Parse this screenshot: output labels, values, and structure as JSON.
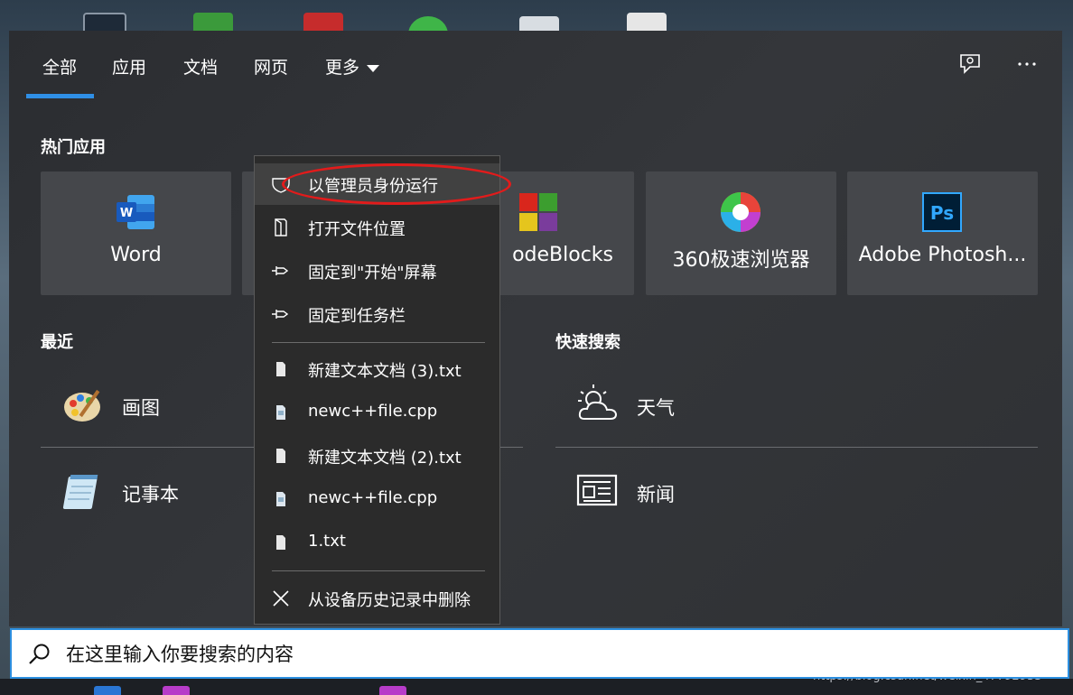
{
  "tabs": [
    {
      "label": "全部"
    },
    {
      "label": "应用"
    },
    {
      "label": "文档"
    },
    {
      "label": "网页"
    },
    {
      "label": "更多"
    }
  ],
  "top_actions": {
    "feedback_icon": "feedback-icon",
    "more_icon": "more-options-icon"
  },
  "sections": {
    "top_apps": "热门应用",
    "recent": "最近",
    "quick_search": "快速搜索"
  },
  "top_apps": [
    {
      "label": "Word",
      "icon": "word-icon",
      "color": "#185abd"
    },
    {
      "label": "",
      "icon": "hidden-app-icon"
    },
    {
      "label": "odeBlocks",
      "icon": "codeblocks-icon"
    },
    {
      "label": "360极速浏览器",
      "icon": "browser-360-icon"
    },
    {
      "label": "Adobe Photosh...",
      "icon": "photoshop-icon",
      "color": "#31a8ff"
    }
  ],
  "recent": [
    {
      "label": "画图",
      "icon": "paint-icon"
    },
    {
      "label": "记事本",
      "icon": "notepad-icon"
    }
  ],
  "quick_search": [
    {
      "label": "天气",
      "icon": "weather-icon"
    },
    {
      "label": "新闻",
      "icon": "news-icon"
    }
  ],
  "context_menu": {
    "items": [
      {
        "label": "以管理员身份运行",
        "icon": "shield-icon"
      },
      {
        "label": "打开文件位置",
        "icon": "file-location-icon"
      },
      {
        "label": "固定到\"开始\"屏幕",
        "icon": "pin-icon"
      },
      {
        "label": "固定到任务栏",
        "icon": "pin-icon"
      },
      {
        "label": "新建文本文档 (3).txt",
        "icon": "text-file-icon"
      },
      {
        "label": "newc++file.cpp",
        "icon": "cpp-file-icon"
      },
      {
        "label": "新建文本文档 (2).txt",
        "icon": "text-file-icon"
      },
      {
        "label": "newc++file.cpp",
        "icon": "cpp-file-icon"
      },
      {
        "label": "1.txt",
        "icon": "text-file-icon"
      },
      {
        "label": "从设备历史记录中删除",
        "icon": "close-icon"
      }
    ]
  },
  "search": {
    "placeholder": "在这里输入你要搜索的内容"
  },
  "watermark": "https://blog.csdn.net/weixin_47792933",
  "colors": {
    "accent": "#2f8fe6",
    "highlight_ellipse": "#e21b1b"
  }
}
